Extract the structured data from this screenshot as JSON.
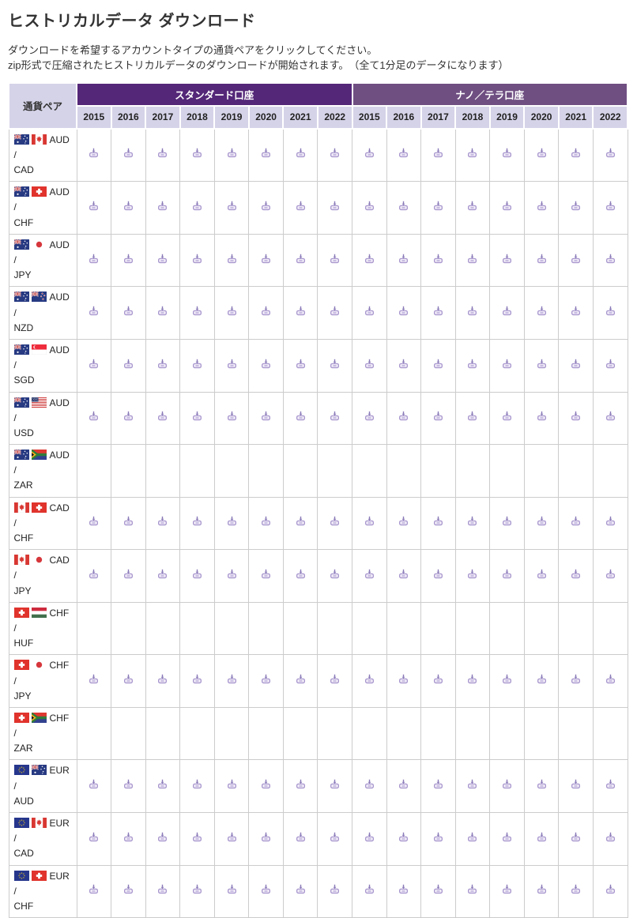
{
  "page": {
    "title": "ヒストリカルデータ ダウンロード",
    "instructions": [
      "ダウンロードを希望するアカウントタイプの通貨ペアをクリックしてください。",
      "zip形式で圧縮されたヒストリカルデータのダウンロードが開始されます。　（全て1分足のデータになります）"
    ]
  },
  "table": {
    "pair_header": "通貨ペア",
    "pair_separator": "/",
    "groups": [
      {
        "label": "スタンダード口座",
        "color": "#542778"
      },
      {
        "label": "ナノ／テラ口座",
        "color": "#6f4f82"
      }
    ],
    "years": [
      "2015",
      "2016",
      "2017",
      "2018",
      "2019",
      "2020",
      "2021",
      "2022"
    ],
    "rows": [
      {
        "base": "AUD",
        "quote": "CAD",
        "flags": [
          "au",
          "ca"
        ],
        "standard": [
          true,
          true,
          true,
          true,
          true,
          true,
          true,
          true
        ],
        "nano": [
          true,
          true,
          true,
          true,
          true,
          true,
          true,
          true
        ]
      },
      {
        "base": "AUD",
        "quote": "CHF",
        "flags": [
          "au",
          "ch"
        ],
        "standard": [
          true,
          true,
          true,
          true,
          true,
          true,
          true,
          true
        ],
        "nano": [
          true,
          true,
          true,
          true,
          true,
          true,
          true,
          true
        ]
      },
      {
        "base": "AUD",
        "quote": "JPY",
        "flags": [
          "au",
          "jp"
        ],
        "standard": [
          true,
          true,
          true,
          true,
          true,
          true,
          true,
          true
        ],
        "nano": [
          true,
          true,
          true,
          true,
          true,
          true,
          true,
          true
        ]
      },
      {
        "base": "AUD",
        "quote": "NZD",
        "flags": [
          "au",
          "nz"
        ],
        "standard": [
          true,
          true,
          true,
          true,
          true,
          true,
          true,
          true
        ],
        "nano": [
          true,
          true,
          true,
          true,
          true,
          true,
          true,
          true
        ]
      },
      {
        "base": "AUD",
        "quote": "SGD",
        "flags": [
          "au",
          "sg"
        ],
        "standard": [
          true,
          true,
          true,
          true,
          true,
          true,
          true,
          true
        ],
        "nano": [
          true,
          true,
          true,
          true,
          true,
          true,
          true,
          true
        ]
      },
      {
        "base": "AUD",
        "quote": "USD",
        "flags": [
          "au",
          "us"
        ],
        "standard": [
          true,
          true,
          true,
          true,
          true,
          true,
          true,
          true
        ],
        "nano": [
          true,
          true,
          true,
          true,
          true,
          true,
          true,
          true
        ]
      },
      {
        "base": "AUD",
        "quote": "ZAR",
        "flags": [
          "au",
          "za"
        ],
        "standard": [
          false,
          false,
          false,
          false,
          false,
          false,
          false,
          false
        ],
        "nano": [
          false,
          false,
          false,
          false,
          false,
          false,
          false,
          false
        ]
      },
      {
        "base": "CAD",
        "quote": "CHF",
        "flags": [
          "ca",
          "ch"
        ],
        "standard": [
          true,
          true,
          true,
          true,
          true,
          true,
          true,
          true
        ],
        "nano": [
          true,
          true,
          true,
          true,
          true,
          true,
          true,
          true
        ]
      },
      {
        "base": "CAD",
        "quote": "JPY",
        "flags": [
          "ca",
          "jp"
        ],
        "standard": [
          true,
          true,
          true,
          true,
          true,
          true,
          true,
          true
        ],
        "nano": [
          true,
          true,
          true,
          true,
          true,
          true,
          true,
          true
        ]
      },
      {
        "base": "CHF",
        "quote": "HUF",
        "flags": [
          "ch",
          "hu"
        ],
        "standard": [
          false,
          false,
          false,
          false,
          false,
          false,
          false,
          false
        ],
        "nano": [
          false,
          false,
          false,
          false,
          false,
          false,
          false,
          false
        ]
      },
      {
        "base": "CHF",
        "quote": "JPY",
        "flags": [
          "ch",
          "jp"
        ],
        "standard": [
          true,
          true,
          true,
          true,
          true,
          true,
          true,
          true
        ],
        "nano": [
          true,
          true,
          true,
          true,
          true,
          true,
          true,
          true
        ]
      },
      {
        "base": "CHF",
        "quote": "ZAR",
        "flags": [
          "ch",
          "za"
        ],
        "standard": [
          false,
          false,
          false,
          false,
          false,
          false,
          false,
          false
        ],
        "nano": [
          false,
          false,
          false,
          false,
          false,
          false,
          false,
          false
        ]
      },
      {
        "base": "EUR",
        "quote": "AUD",
        "flags": [
          "eu",
          "au"
        ],
        "standard": [
          true,
          true,
          true,
          true,
          true,
          true,
          true,
          true
        ],
        "nano": [
          true,
          true,
          true,
          true,
          true,
          true,
          true,
          true
        ]
      },
      {
        "base": "EUR",
        "quote": "CAD",
        "flags": [
          "eu",
          "ca"
        ],
        "standard": [
          true,
          true,
          true,
          true,
          true,
          true,
          true,
          true
        ],
        "nano": [
          true,
          true,
          true,
          true,
          true,
          true,
          true,
          true
        ]
      },
      {
        "base": "EUR",
        "quote": "CHF",
        "flags": [
          "eu",
          "ch"
        ],
        "standard": [
          true,
          true,
          true,
          true,
          true,
          true,
          true,
          true
        ],
        "nano": [
          true,
          true,
          true,
          true,
          true,
          true,
          true,
          true
        ]
      }
    ]
  },
  "icons": {
    "download": "download-tray-icon"
  },
  "colors": {
    "standard_header_bg": "#542778",
    "nano_header_bg": "#6f4f82",
    "subheader_bg": "#d5d3e8",
    "cell_border": "#cccccc",
    "download_icon": "#a796cd",
    "text": "#333333"
  }
}
